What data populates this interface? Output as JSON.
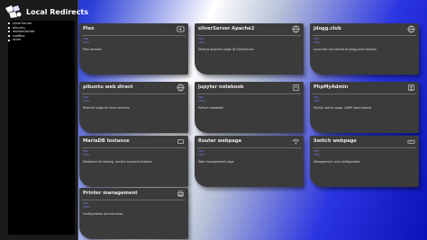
{
  "app": {
    "title": "Local Redirects"
  },
  "sidebar": {
    "items": [
      {
        "label": "silverServer"
      },
      {
        "label": "pibuntu"
      },
      {
        "label": "debianDocker"
      },
      {
        "label": "raidBox"
      },
      {
        "label": "other"
      }
    ]
  },
  "cards": [
    {
      "title": "Plex",
      "link1": "http",
      "link2": "https",
      "description": "Plex location",
      "icon": "plex-icon"
    },
    {
      "title": "silverServer Apache2",
      "link1": "http",
      "link2": "https",
      "description": "Default Apache2 page @ silverServer",
      "icon": "globe-icon"
    },
    {
      "title": "jdogg.club",
      "link1": "http",
      "link2": "https",
      "description": "Local site connected to jdogg.club domain",
      "icon": "globe-icon"
    },
    {
      "title": "pibuntu web direct",
      "link1": "http",
      "link2": "https",
      "description": "Redirect page for local services",
      "icon": "globe-icon"
    },
    {
      "title": "jupyter notebook",
      "link1": "http",
      "link2": "https",
      "description": "Python notebook",
      "icon": "notebook-icon"
    },
    {
      "title": "PhpMyAdmin",
      "link1": "http",
      "link2": "https",
      "description": "MySQL admin page, LAMP stack based",
      "icon": "database-icon"
    },
    {
      "title": "MariaDB Instance",
      "link1": "http",
      "link2": "https",
      "description": "Database for testing, remote accessit enabled",
      "icon": "controller-icon"
    },
    {
      "title": "Router webpage",
      "link1": "http",
      "link2": "https",
      "description": "Web management page",
      "icon": "wifi-icon"
    },
    {
      "title": "Switch webpage",
      "link1": "http",
      "link2": "https",
      "description": "Management and configuration",
      "icon": "switch-icon"
    },
    {
      "title": "Printer management",
      "link1": "http",
      "link2": "https",
      "description": "Configuration and services",
      "icon": "printer-icon"
    }
  ]
}
